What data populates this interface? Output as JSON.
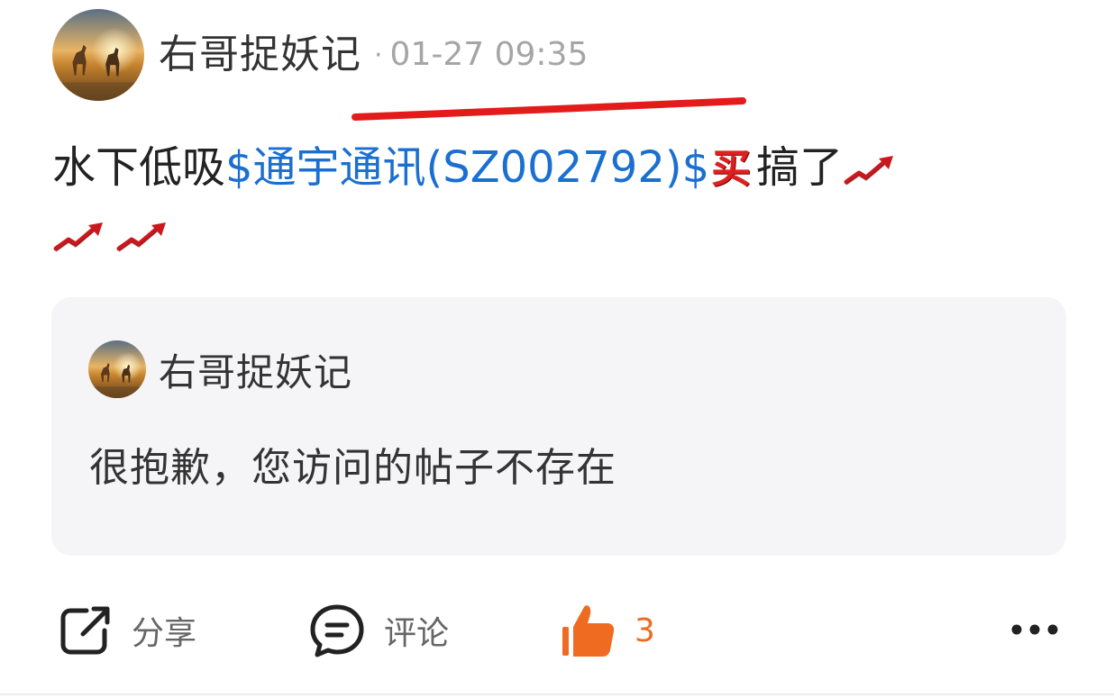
{
  "post": {
    "author": "右哥捉妖记",
    "separator": "·",
    "timestamp": "01-27 09:35",
    "avatar_icon": "horses-sunset-avatar",
    "content": {
      "prefix": "水下低吸",
      "stock_link": "$通宇通讯(SZ002792)$",
      "buy_badge": "买",
      "suffix": "搞了",
      "trend_icon": "stock-rising-chart-emoji",
      "trend_icon_count": 3
    },
    "annotation_color": "#e41b1b"
  },
  "quote": {
    "author": "右哥捉妖记",
    "avatar_icon": "horses-sunset-avatar",
    "text": "很抱歉，您访问的帖子不存在"
  },
  "actions": {
    "share": {
      "label": "分享",
      "icon": "share-icon"
    },
    "comment": {
      "label": "评论",
      "icon": "comment-icon"
    },
    "like": {
      "count": "3",
      "icon": "thumbs-up-icon",
      "color": "#ef6b22"
    },
    "more": {
      "icon": "more-dots-icon"
    }
  },
  "colors": {
    "link": "#1a6fd0",
    "secondary_text": "#a5a5a5",
    "card_background": "#f5f5f7"
  }
}
